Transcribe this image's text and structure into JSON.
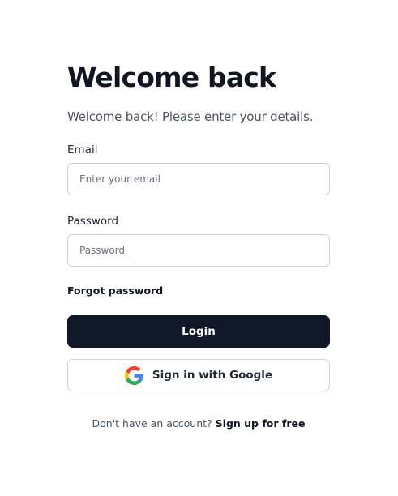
{
  "header": {
    "title": "Welcome back",
    "subtitle": "Welcome back! Please enter your details."
  },
  "form": {
    "email": {
      "label": "Email",
      "placeholder": "Enter your email",
      "value": ""
    },
    "password": {
      "label": "Password",
      "placeholder": "Password",
      "value": ""
    },
    "forgot_password_label": "Forgot password",
    "login_label": "Login",
    "google_label": "Sign in with Google"
  },
  "footer": {
    "prompt": "Don't have an account?",
    "signup_label": "Sign up for free"
  },
  "icons": {
    "google": "google-icon"
  },
  "colors": {
    "primary_button": "#101827",
    "input_border": "#d1d5db",
    "google_blue": "#4285F4",
    "google_red": "#EA4335",
    "google_yellow": "#FBBC05",
    "google_green": "#34A853"
  }
}
